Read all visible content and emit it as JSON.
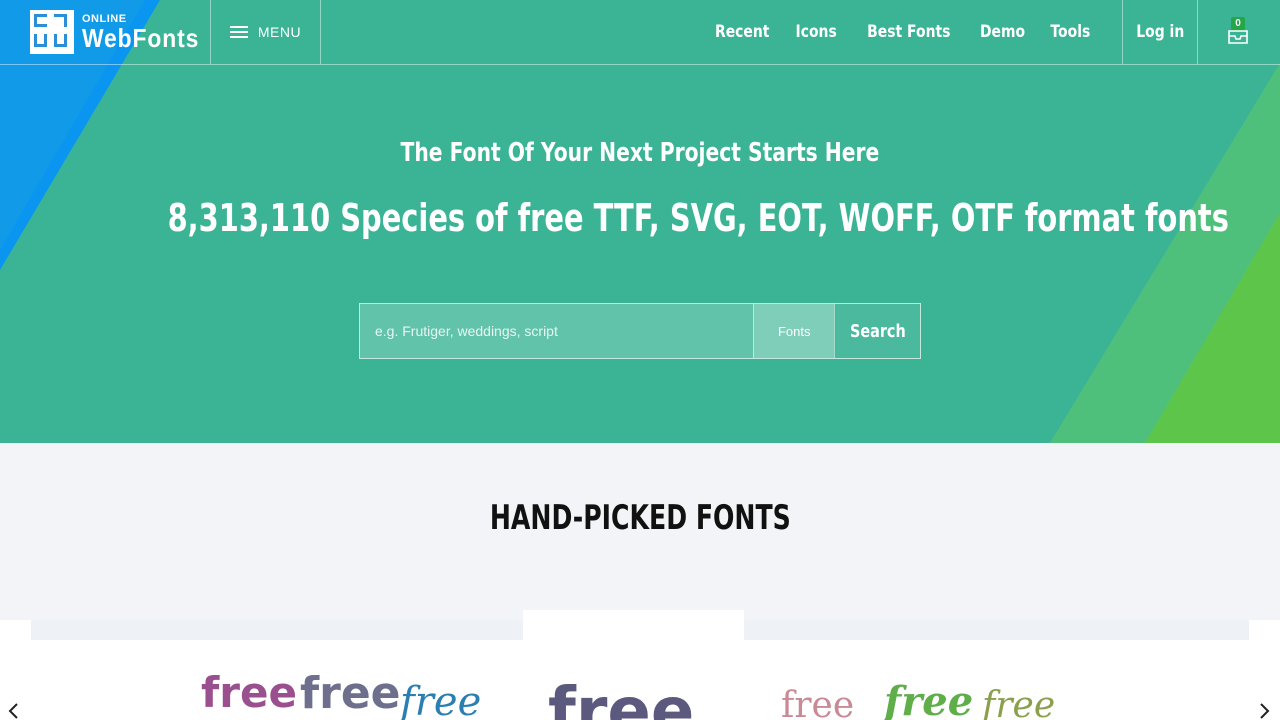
{
  "logo": {
    "small": "ONLINE",
    "big": "WebFonts"
  },
  "menu": {
    "label": "MENU"
  },
  "nav": [
    "Recent",
    "Icons",
    "Best Fonts",
    "Demo",
    "Tools"
  ],
  "login": "Log in",
  "cart": {
    "count": "0"
  },
  "hero": {
    "tagline": "The Font Of Your Next Project Starts Here",
    "headline": "8,313,110 Species of free TTF, SVG, EOT, WOFF, OTF format fonts"
  },
  "search": {
    "placeholder": "e.g. Frutiger, weddings, script",
    "type": "Fonts",
    "button": "Search"
  },
  "section": {
    "title": "HAND-PICKED FONTS"
  },
  "previews": [
    "free",
    "free",
    "free",
    "free",
    "free",
    "free",
    "free"
  ],
  "colors": {
    "hero": "#3bb496",
    "accent_blue": "#0a96f0",
    "accent_green": "#5dc64a",
    "badge": "#25a64a"
  },
  "icons": [
    "burger-icon",
    "cart-icon",
    "chevron-left-icon",
    "chevron-right-icon"
  ]
}
